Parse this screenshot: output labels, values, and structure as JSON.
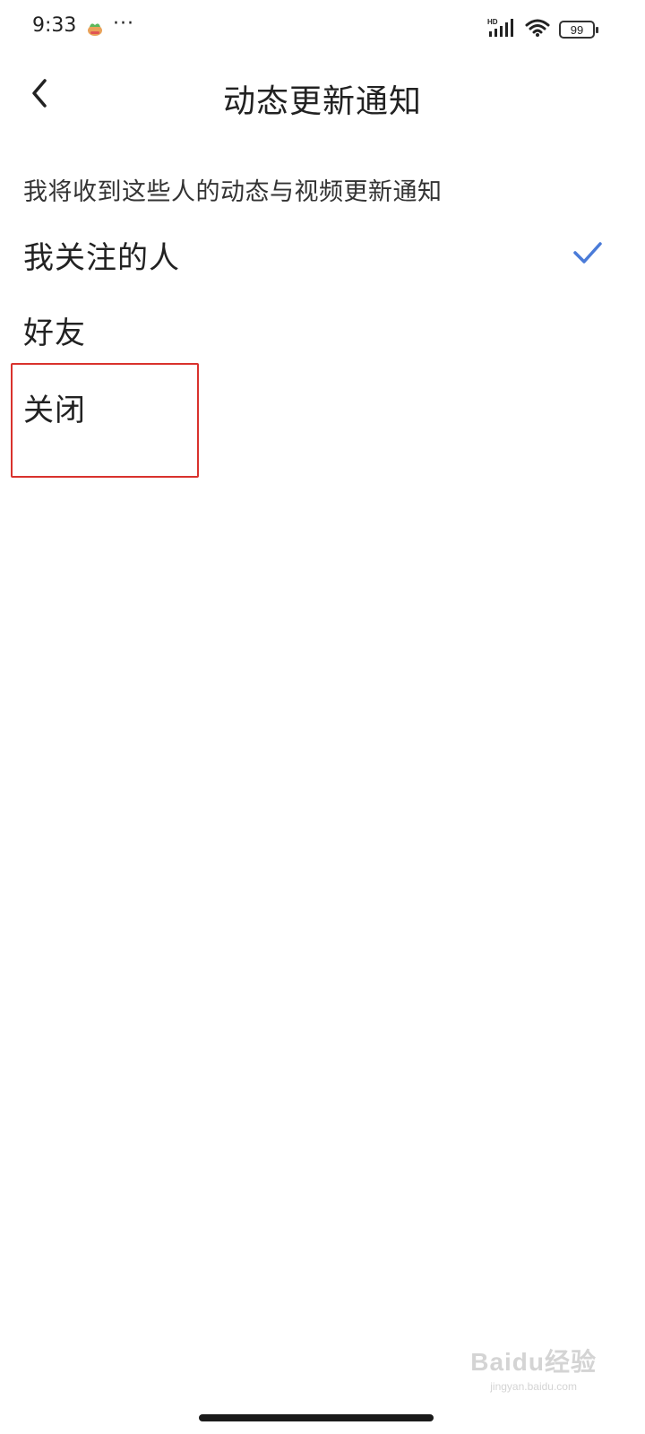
{
  "status_bar": {
    "time": "9:33",
    "more_indicator": "···",
    "network_label": "HD",
    "battery_level": "99",
    "icons": [
      "app-notification-icon",
      "signal-icon",
      "wifi-icon",
      "battery-icon"
    ]
  },
  "header": {
    "title": "动态更新通知",
    "back_icon": "chevron-left-icon"
  },
  "section": {
    "description": "我将收到这些人的动态与视频更新通知"
  },
  "options": [
    {
      "label": "我关注的人",
      "selected": true
    },
    {
      "label": "好友",
      "selected": false
    },
    {
      "label": "关闭",
      "selected": false
    }
  ],
  "colors": {
    "accent_check": "#4a7bd8",
    "highlight_box": "#d9322d",
    "text": "#222222"
  },
  "watermark": {
    "main": "Baidu经验",
    "sub": "jingyan.baidu.com"
  }
}
